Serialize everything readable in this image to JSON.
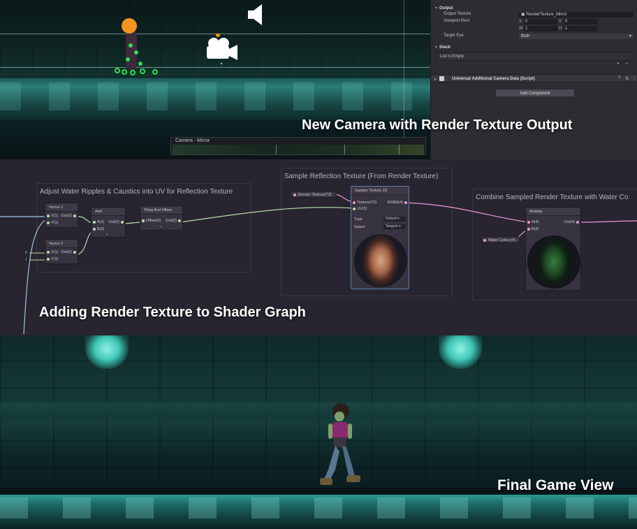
{
  "inspector": {
    "output_header": "Output",
    "output_texture_label": "Output Texture",
    "output_texture_value": "RenderTexture_Mirror",
    "viewport_rect_label": "Viewport Rect",
    "viewport_x_label": "X",
    "viewport_x": "0",
    "viewport_y_label": "Y",
    "viewport_y": "0",
    "viewport_w_label": "W",
    "viewport_w": "1",
    "viewport_h_label": "H",
    "viewport_h": "1",
    "target_eye_label": "Target Eye",
    "target_eye_value": "Both",
    "stack_header": "Stack",
    "stack_empty": "List is Empty",
    "plus": "+",
    "minus": "−",
    "component_title": "Universal Additional Camera Data (Script)",
    "add_component": "Add Component"
  },
  "scene": {
    "mirror_preview_title": "Camera - Mirror"
  },
  "captions": {
    "camera": "New Camera with Render Texture Output",
    "shader": "Adding Render Texture to Shader Graph",
    "game": "Final Game View"
  },
  "graph": {
    "groups": {
      "ripples": "Adjust Water Ripples & Caustics into UV for Reflection Texture",
      "sample": "Sample Reflection Texture (From Render Texture)",
      "combine": "Combine Sampled Render Texture with Water Co"
    },
    "nodes": {
      "vec2_a": {
        "title": "Vector 2",
        "x": "X(1)",
        "y": "Y(1)",
        "out": "Out(2)"
      },
      "vec2_b": {
        "title": "Vector 2",
        "x": "X(1)",
        "y": "Y(1)",
        "out": "Out(2)",
        "x_val": "0",
        "y_val": "1"
      },
      "add": {
        "title": "Add",
        "a": "A(2)",
        "b": "B(2)",
        "out": "Out(2)"
      },
      "tiling": {
        "title": "Tiling And Offset",
        "offset": "Offset(2)",
        "out": "Out(2)"
      },
      "sample": {
        "title": "Sample Texture 2D",
        "tex": "Texture(T2)",
        "uv": "UV(2)",
        "out": "RGBA(4)",
        "type_label": "Type",
        "type_value": "Default",
        "space_label": "Space",
        "space_value": "Tangent"
      },
      "multiply": {
        "title": "Multiply",
        "a": "A(4)",
        "b": "B(4)",
        "out": "Out(4)"
      }
    },
    "properties": {
      "render_texture": "Render Texture(T2)",
      "water_colour": "Water Colour(4)"
    }
  }
}
